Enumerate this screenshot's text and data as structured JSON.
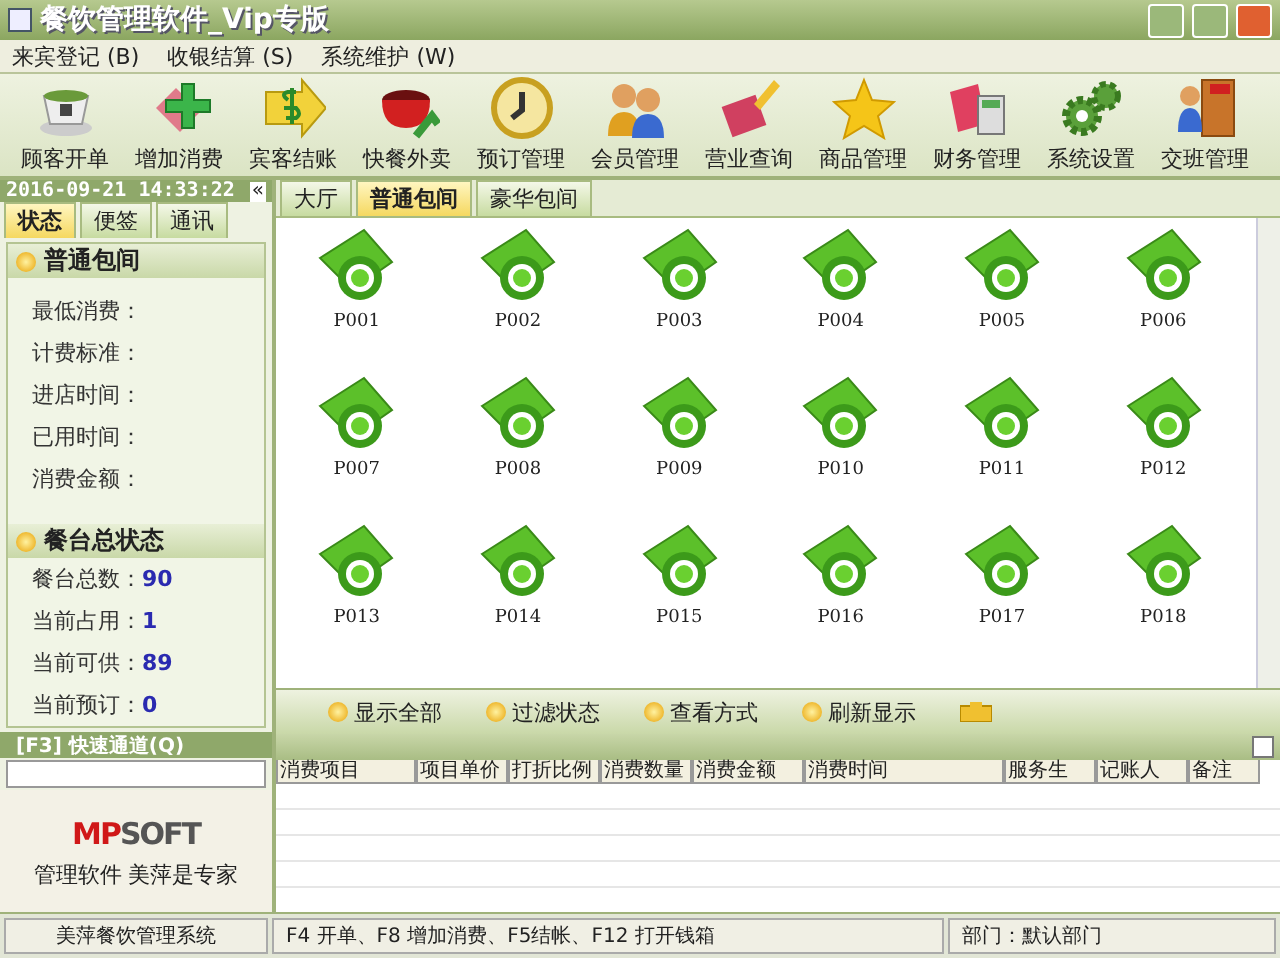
{
  "window": {
    "title": "餐饮管理软件_Vip专版"
  },
  "menu": [
    "来宾登记 (B)",
    "收银结算 (S)",
    "系统维护 (W)"
  ],
  "toolbar": [
    {
      "label": "顾客开单"
    },
    {
      "label": "增加消费"
    },
    {
      "label": "宾客结账"
    },
    {
      "label": "快餐外卖"
    },
    {
      "label": "预订管理"
    },
    {
      "label": "会员管理"
    },
    {
      "label": "营业查询"
    },
    {
      "label": "商品管理"
    },
    {
      "label": "财务管理"
    },
    {
      "label": "系统设置"
    },
    {
      "label": "交班管理"
    }
  ],
  "sidebar": {
    "datetime": "2016-09-21  14:33:22",
    "collapse": "«",
    "tabs": [
      {
        "label": "状态",
        "selected": true
      },
      {
        "label": "便签",
        "selected": false
      },
      {
        "label": "通讯",
        "selected": false
      }
    ],
    "room_info": {
      "title": "普通包间",
      "fields": [
        {
          "label": "最低消费："
        },
        {
          "label": "计费标准："
        },
        {
          "label": "进店时间："
        },
        {
          "label": "已用时间："
        },
        {
          "label": "消费金额："
        }
      ]
    },
    "table_status": {
      "title": "餐台总状态",
      "fields": [
        {
          "label": "餐台总数：",
          "value": "90"
        },
        {
          "label": "当前占用：",
          "value": "1"
        },
        {
          "label": "当前可供：",
          "value": "89"
        },
        {
          "label": "当前预订：",
          "value": "0"
        }
      ]
    },
    "quick_channel": {
      "title": "[F3] 快速通道(Q)"
    },
    "logo": {
      "accent": "MP",
      "rest": "SOFT"
    },
    "slogan": "管理软件 美萍是专家"
  },
  "room_tabs": [
    {
      "label": "大厅",
      "selected": false
    },
    {
      "label": "普通包间",
      "selected": true
    },
    {
      "label": "豪华包间",
      "selected": false
    }
  ],
  "rooms": [
    "P001",
    "P002",
    "P003",
    "P004",
    "P005",
    "P006",
    "P007",
    "P008",
    "P009",
    "P010",
    "P011",
    "P012",
    "P013",
    "P014",
    "P015",
    "P016",
    "P017",
    "P018"
  ],
  "room_actions": [
    "显示全部",
    "过滤状态",
    "查看方式",
    "刷新显示"
  ],
  "table": {
    "columns": [
      "消费项目",
      "项目单价",
      "打折比例",
      "消费数量",
      "消费金额",
      "消费时间",
      "服务生",
      "记账人",
      "备注"
    ]
  },
  "status_bar": [
    "美萍餐饮管理系统",
    "F4 开单、F8 增加消费、F5结帐、F12 打开钱箱",
    "部门：默认部门"
  ]
}
